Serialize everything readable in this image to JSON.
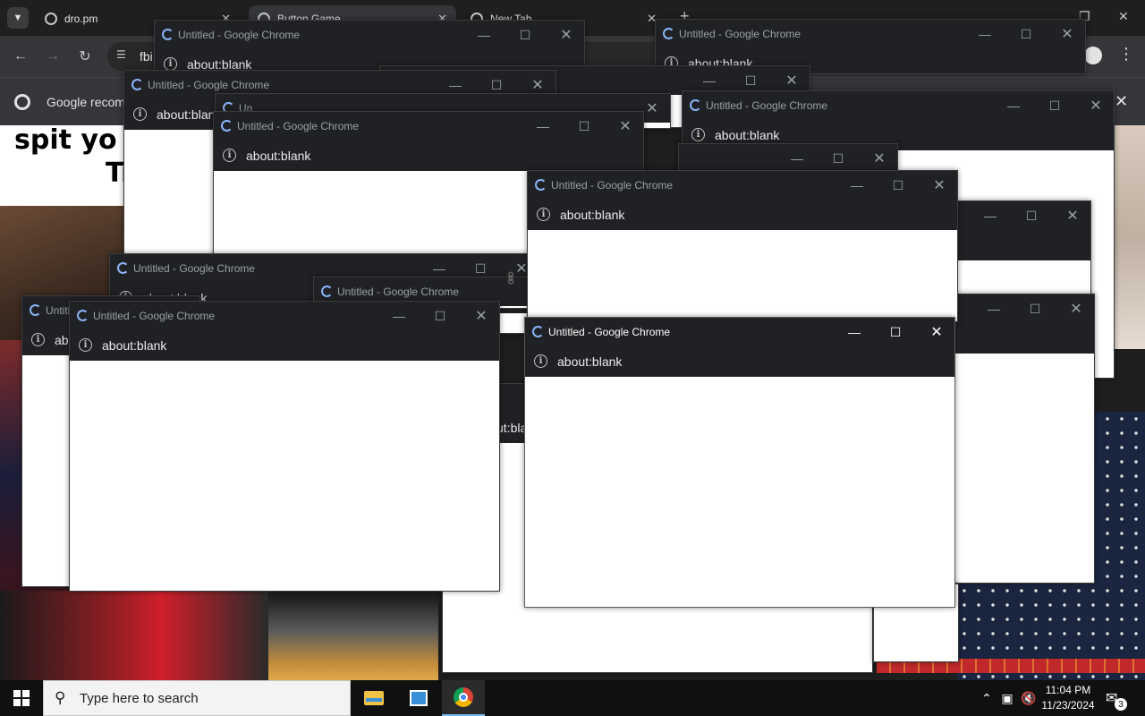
{
  "background_browser": {
    "tabs": [
      {
        "label": "dro.pm"
      },
      {
        "label": "Button Game"
      },
      {
        "label": "New Tab"
      }
    ],
    "omnibox_text": "fbi",
    "infobar_text": "Google recomm",
    "meme_line1": "spit yo sh",
    "meme_line2": "Tr"
  },
  "popup": {
    "title": "Untitled - Google Chrome",
    "url": "about:blank",
    "partial_title_short": "Un",
    "partial_title_stub": "Untitl",
    "partial_url": "ab",
    "partial_url_blank": "about:blan",
    "partial_url_tail": "ut:bla"
  },
  "icons": {
    "minimize": "minimize-icon",
    "maximize": "maximize-icon",
    "close": "close-icon",
    "info": "info-icon",
    "loading": "loading-spinner-icon"
  },
  "taskbar": {
    "search_placeholder": "Type here to search",
    "time": "11:04 PM",
    "date": "11/23/2024",
    "notification_count": "3"
  },
  "colors": {
    "titlebar": "#202124",
    "spinner": "#8ab4f8",
    "taskbar": "#101010"
  }
}
